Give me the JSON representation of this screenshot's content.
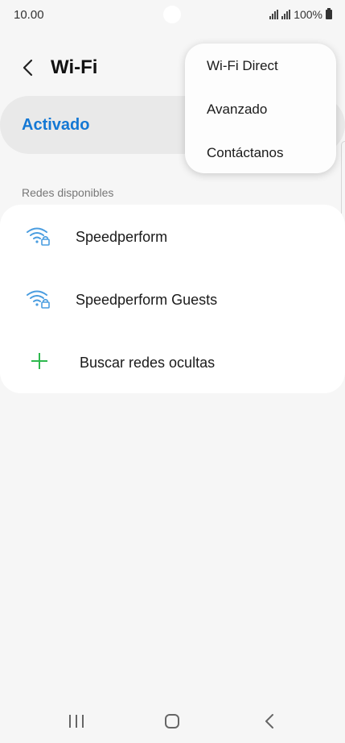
{
  "status_bar": {
    "time": "10.00",
    "battery": "100%"
  },
  "header": {
    "title": "Wi-Fi"
  },
  "master_switch": {
    "label": "Activado",
    "on": true
  },
  "networks": {
    "section_title": "Redes disponibles",
    "items": [
      {
        "name": "Speedperform",
        "icon": "wifi-locked-icon"
      },
      {
        "name": "Speedperform Guests",
        "icon": "wifi-locked-icon"
      }
    ],
    "add_hidden_label": "Buscar redes ocultas"
  },
  "menu": {
    "items": [
      {
        "label": "Wi-Fi Direct"
      },
      {
        "label": "Avanzado"
      },
      {
        "label": "Contáctanos"
      }
    ]
  },
  "colors": {
    "accent": "#1478d4",
    "wifi_icon": "#4a9de0",
    "plus_icon": "#2db84d",
    "background": "#f6f6f6"
  }
}
